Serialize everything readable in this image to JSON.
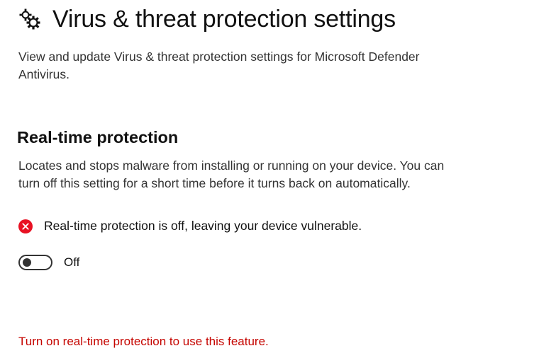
{
  "header": {
    "icon": "gears-icon",
    "title": "Virus & threat protection settings"
  },
  "description": "View and update Virus & threat protection settings for Microsoft Defender Antivirus.",
  "realtime": {
    "title": "Real-time protection",
    "description": "Locates and stops malware from installing or running on your device. You can turn off this setting for a short time before it turns back on automatically.",
    "status_icon": "error-icon",
    "status_text": "Real-time protection is off, leaving your device vulnerable.",
    "toggle_state": "Off"
  },
  "feature_warning": "Turn on real-time protection to use this feature.",
  "colors": {
    "error_red": "#e81123",
    "warning_text": "#c50500"
  }
}
